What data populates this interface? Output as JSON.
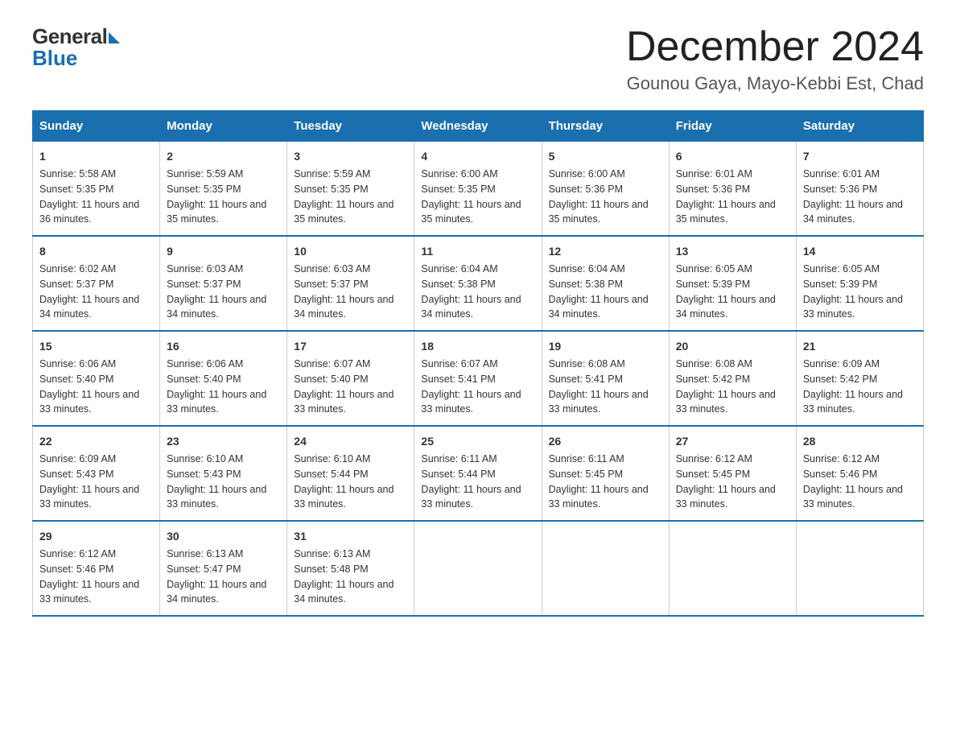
{
  "logo": {
    "general": "General",
    "blue": "Blue"
  },
  "header": {
    "month": "December 2024",
    "location": "Gounou Gaya, Mayo-Kebbi Est, Chad"
  },
  "days": [
    "Sunday",
    "Monday",
    "Tuesday",
    "Wednesday",
    "Thursday",
    "Friday",
    "Saturday"
  ],
  "weeks": [
    [
      {
        "day": "1",
        "sunrise": "5:58 AM",
        "sunset": "5:35 PM",
        "daylight": "11 hours and 36 minutes."
      },
      {
        "day": "2",
        "sunrise": "5:59 AM",
        "sunset": "5:35 PM",
        "daylight": "11 hours and 35 minutes."
      },
      {
        "day": "3",
        "sunrise": "5:59 AM",
        "sunset": "5:35 PM",
        "daylight": "11 hours and 35 minutes."
      },
      {
        "day": "4",
        "sunrise": "6:00 AM",
        "sunset": "5:35 PM",
        "daylight": "11 hours and 35 minutes."
      },
      {
        "day": "5",
        "sunrise": "6:00 AM",
        "sunset": "5:36 PM",
        "daylight": "11 hours and 35 minutes."
      },
      {
        "day": "6",
        "sunrise": "6:01 AM",
        "sunset": "5:36 PM",
        "daylight": "11 hours and 35 minutes."
      },
      {
        "day": "7",
        "sunrise": "6:01 AM",
        "sunset": "5:36 PM",
        "daylight": "11 hours and 34 minutes."
      }
    ],
    [
      {
        "day": "8",
        "sunrise": "6:02 AM",
        "sunset": "5:37 PM",
        "daylight": "11 hours and 34 minutes."
      },
      {
        "day": "9",
        "sunrise": "6:03 AM",
        "sunset": "5:37 PM",
        "daylight": "11 hours and 34 minutes."
      },
      {
        "day": "10",
        "sunrise": "6:03 AM",
        "sunset": "5:37 PM",
        "daylight": "11 hours and 34 minutes."
      },
      {
        "day": "11",
        "sunrise": "6:04 AM",
        "sunset": "5:38 PM",
        "daylight": "11 hours and 34 minutes."
      },
      {
        "day": "12",
        "sunrise": "6:04 AM",
        "sunset": "5:38 PM",
        "daylight": "11 hours and 34 minutes."
      },
      {
        "day": "13",
        "sunrise": "6:05 AM",
        "sunset": "5:39 PM",
        "daylight": "11 hours and 34 minutes."
      },
      {
        "day": "14",
        "sunrise": "6:05 AM",
        "sunset": "5:39 PM",
        "daylight": "11 hours and 33 minutes."
      }
    ],
    [
      {
        "day": "15",
        "sunrise": "6:06 AM",
        "sunset": "5:40 PM",
        "daylight": "11 hours and 33 minutes."
      },
      {
        "day": "16",
        "sunrise": "6:06 AM",
        "sunset": "5:40 PM",
        "daylight": "11 hours and 33 minutes."
      },
      {
        "day": "17",
        "sunrise": "6:07 AM",
        "sunset": "5:40 PM",
        "daylight": "11 hours and 33 minutes."
      },
      {
        "day": "18",
        "sunrise": "6:07 AM",
        "sunset": "5:41 PM",
        "daylight": "11 hours and 33 minutes."
      },
      {
        "day": "19",
        "sunrise": "6:08 AM",
        "sunset": "5:41 PM",
        "daylight": "11 hours and 33 minutes."
      },
      {
        "day": "20",
        "sunrise": "6:08 AM",
        "sunset": "5:42 PM",
        "daylight": "11 hours and 33 minutes."
      },
      {
        "day": "21",
        "sunrise": "6:09 AM",
        "sunset": "5:42 PM",
        "daylight": "11 hours and 33 minutes."
      }
    ],
    [
      {
        "day": "22",
        "sunrise": "6:09 AM",
        "sunset": "5:43 PM",
        "daylight": "11 hours and 33 minutes."
      },
      {
        "day": "23",
        "sunrise": "6:10 AM",
        "sunset": "5:43 PM",
        "daylight": "11 hours and 33 minutes."
      },
      {
        "day": "24",
        "sunrise": "6:10 AM",
        "sunset": "5:44 PM",
        "daylight": "11 hours and 33 minutes."
      },
      {
        "day": "25",
        "sunrise": "6:11 AM",
        "sunset": "5:44 PM",
        "daylight": "11 hours and 33 minutes."
      },
      {
        "day": "26",
        "sunrise": "6:11 AM",
        "sunset": "5:45 PM",
        "daylight": "11 hours and 33 minutes."
      },
      {
        "day": "27",
        "sunrise": "6:12 AM",
        "sunset": "5:45 PM",
        "daylight": "11 hours and 33 minutes."
      },
      {
        "day": "28",
        "sunrise": "6:12 AM",
        "sunset": "5:46 PM",
        "daylight": "11 hours and 33 minutes."
      }
    ],
    [
      {
        "day": "29",
        "sunrise": "6:12 AM",
        "sunset": "5:46 PM",
        "daylight": "11 hours and 33 minutes."
      },
      {
        "day": "30",
        "sunrise": "6:13 AM",
        "sunset": "5:47 PM",
        "daylight": "11 hours and 34 minutes."
      },
      {
        "day": "31",
        "sunrise": "6:13 AM",
        "sunset": "5:48 PM",
        "daylight": "11 hours and 34 minutes."
      },
      null,
      null,
      null,
      null
    ]
  ]
}
